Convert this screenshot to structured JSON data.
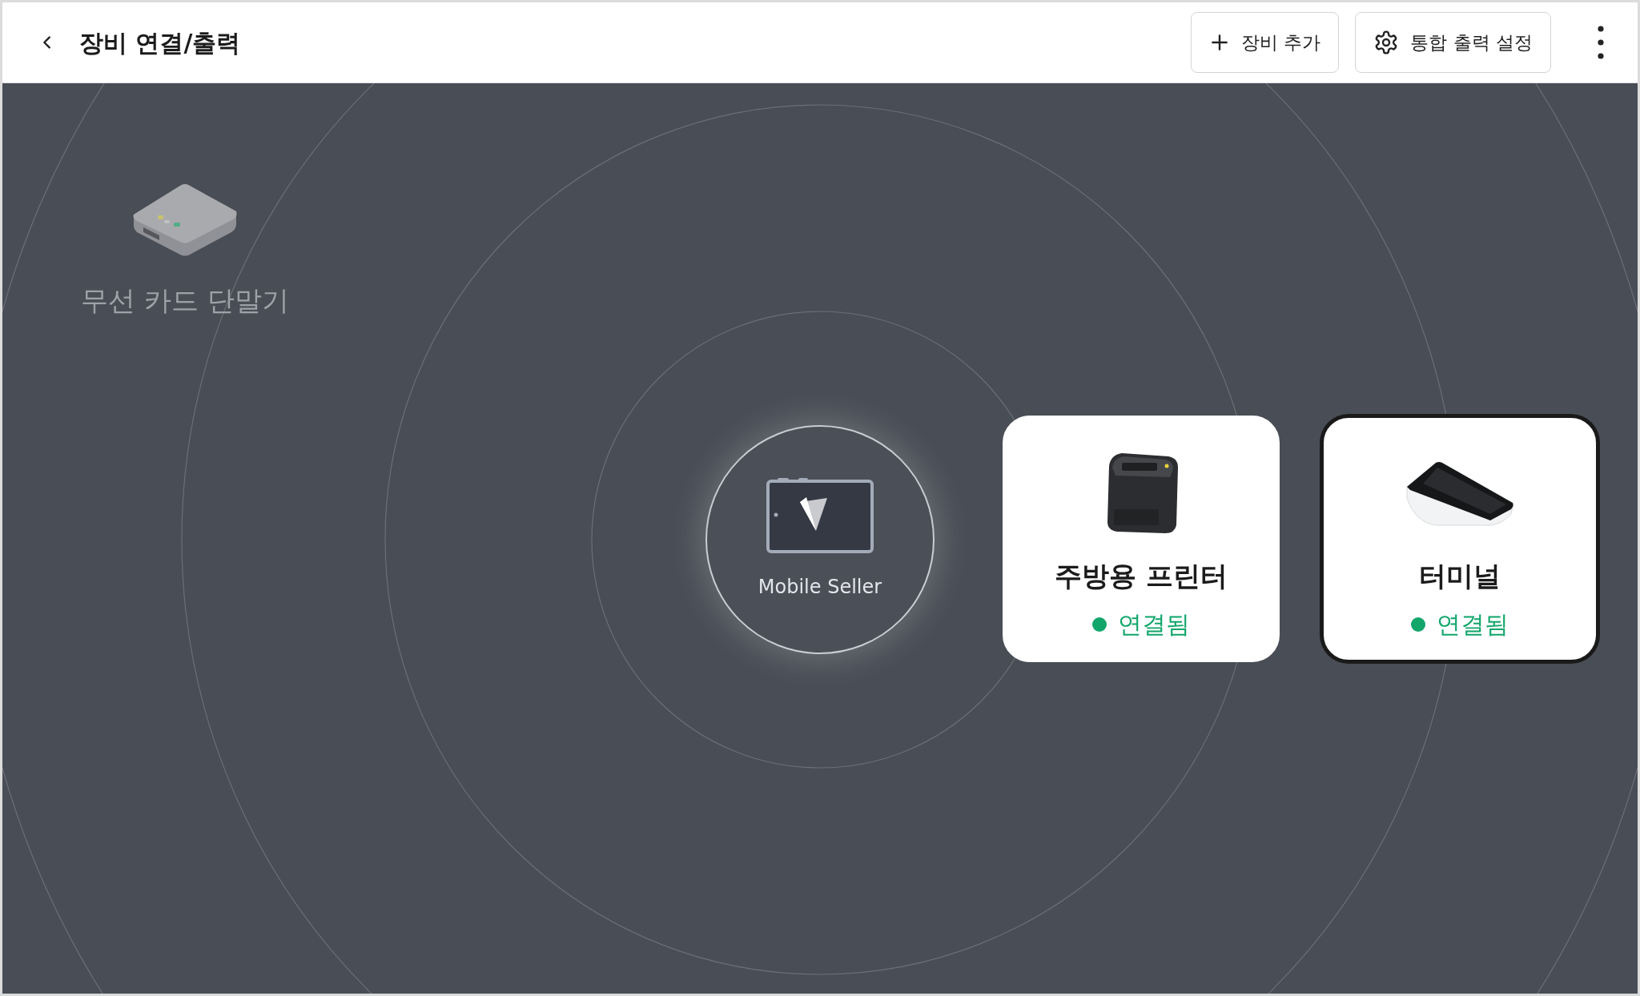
{
  "header": {
    "title": "장비 연결/출력",
    "actions": [
      {
        "kind": "add",
        "label": "장비 추가"
      },
      {
        "kind": "settings",
        "label": "통합 출력 설정"
      }
    ]
  },
  "hub": {
    "label": "Mobile Seller"
  },
  "devices": [
    {
      "kind": "reader",
      "name": "무선 카드 단말기",
      "connected": false
    },
    {
      "kind": "printer",
      "name": "주방용 프린터",
      "connected": true,
      "status": "연결됨",
      "color": "#12a66b",
      "selected": false
    },
    {
      "kind": "terminal",
      "name": "터미널",
      "connected": true,
      "status": "연결됨",
      "color": "#12a66b",
      "selected": true
    }
  ]
}
